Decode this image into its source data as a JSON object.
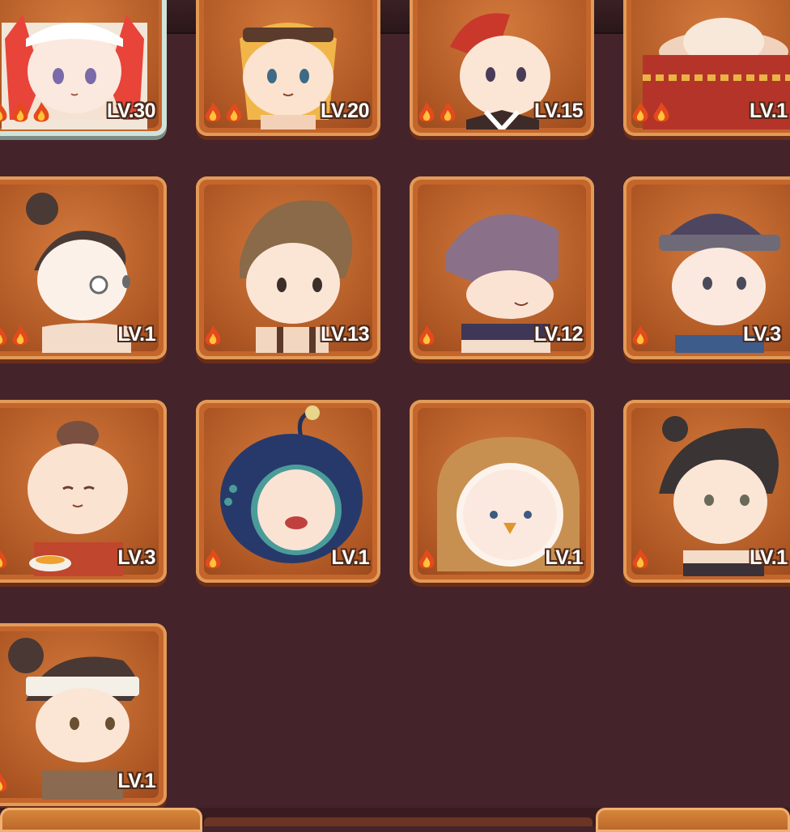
{
  "cards": [
    {
      "id": "c1",
      "level": "LV.30",
      "flames": 3,
      "selected": true
    },
    {
      "id": "c2",
      "level": "LV.20",
      "flames": 2
    },
    {
      "id": "c3",
      "level": "LV.15",
      "flames": 2
    },
    {
      "id": "c4",
      "level": "LV.1",
      "flames": 2
    },
    {
      "id": "c5",
      "level": "LV.1",
      "flames": 2
    },
    {
      "id": "c6",
      "level": "LV.13",
      "flames": 1
    },
    {
      "id": "c7",
      "level": "LV.12",
      "flames": 1
    },
    {
      "id": "c8",
      "level": "LV.3",
      "flames": 1
    },
    {
      "id": "c9",
      "level": "LV.3",
      "flames": 1
    },
    {
      "id": "c10",
      "level": "LV.1",
      "flames": 1
    },
    {
      "id": "c11",
      "level": "LV.1",
      "flames": 1
    },
    {
      "id": "c12",
      "level": "LV.1",
      "flames": 1
    },
    {
      "id": "c13",
      "level": "LV.1",
      "flames": 1
    }
  ],
  "bottom": {
    "left_label": "",
    "right_label": ""
  },
  "colors": {
    "background": "#45232a",
    "card": "#c4662c",
    "level_text": "#ffffff"
  }
}
